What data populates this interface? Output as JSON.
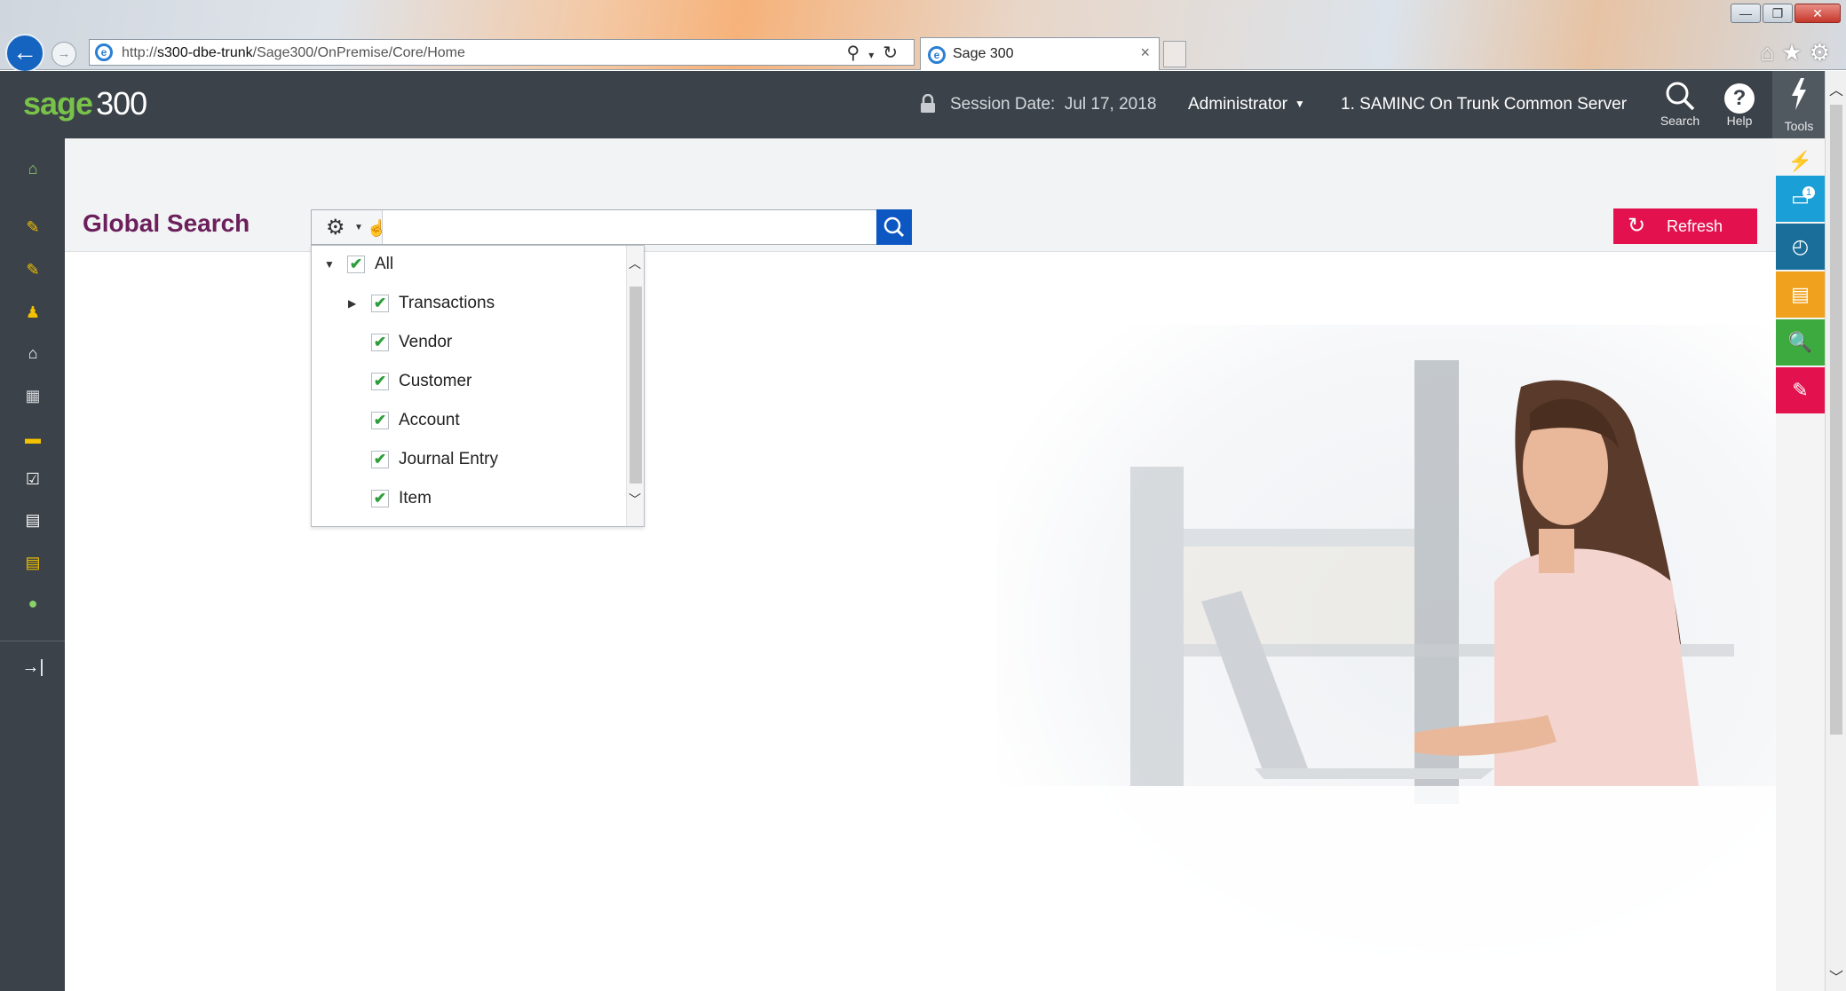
{
  "browser": {
    "url_prefix": "http://",
    "url_host": "s300-dbe-trunk",
    "url_path": "/Sage300/OnPremise/Core/Home",
    "tab_title": "Sage 300",
    "tab_close": "×"
  },
  "app": {
    "logo_sage": "sage",
    "logo_num": "300",
    "session_label": "Session Date:",
    "session_date": "Jul 17, 2018",
    "user": "Administrator",
    "company": "1. SAMINC On Trunk Common Server",
    "tools": {
      "search": "Search",
      "help": "Help",
      "tools": "Tools"
    }
  },
  "left_nav": {
    "items": [
      "home-icon",
      "ap-module-icon",
      "ar-module-icon",
      "customers-icon",
      "bank-icon",
      "inventory-icon",
      "order-entry-icon",
      "purchase-order-icon",
      "project-icon",
      "payroll-icon",
      "tax-icon",
      "collapse-nav-icon"
    ]
  },
  "right_strip": {
    "windows_badge": "1"
  },
  "main": {
    "page_title": "Global Search",
    "search_placeholder": "",
    "refresh_label": "Refresh",
    "filters": [
      {
        "label": "All",
        "checked": true,
        "level": 0,
        "expandable": "expanded"
      },
      {
        "label": "Transactions",
        "checked": true,
        "level": 1,
        "expandable": "collapsed"
      },
      {
        "label": "Vendor",
        "checked": true,
        "level": 1
      },
      {
        "label": "Customer",
        "checked": true,
        "level": 1
      },
      {
        "label": "Account",
        "checked": true,
        "level": 1
      },
      {
        "label": "Journal Entry",
        "checked": true,
        "level": 1
      },
      {
        "label": "Item",
        "checked": true,
        "level": 1
      }
    ]
  },
  "colors": {
    "header": "#3b4249",
    "title": "#6b1f5b",
    "refresh": "#e3124f",
    "search_button": "#0d57c2",
    "check": "#2e9e3b"
  }
}
